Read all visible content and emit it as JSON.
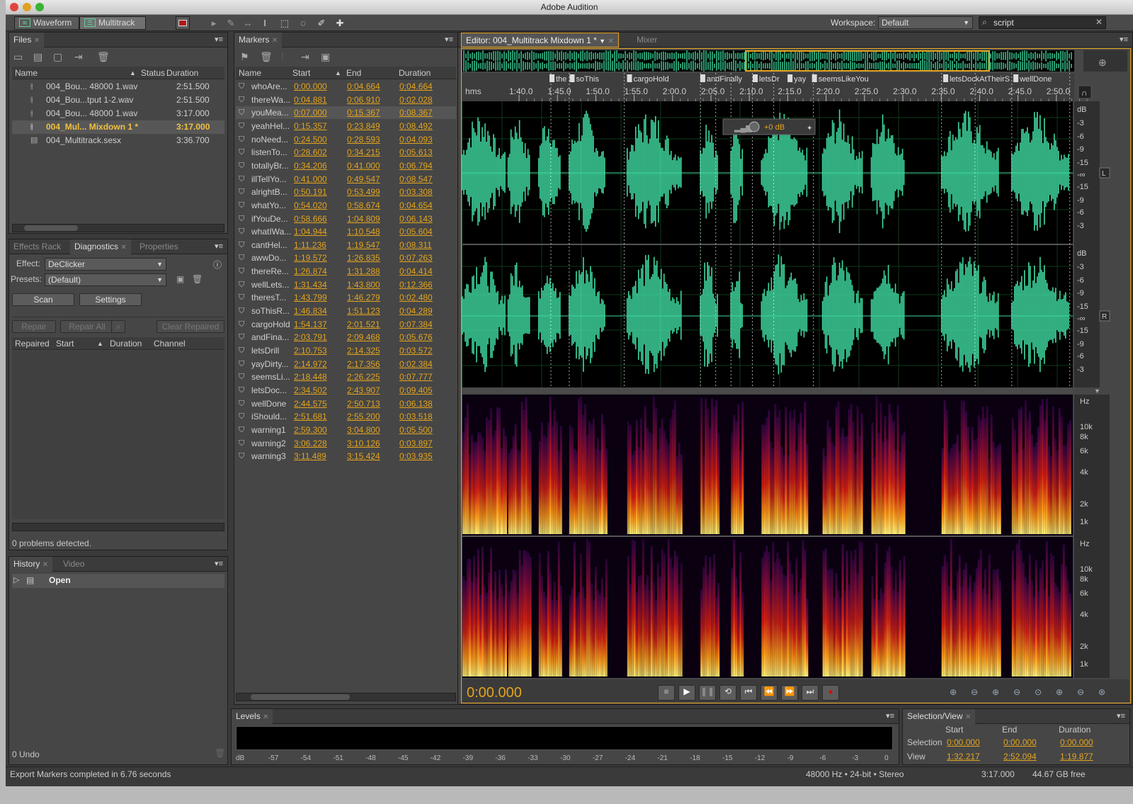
{
  "app": {
    "title": "Adobe Audition"
  },
  "toolbar": {
    "waveform_label": "Waveform",
    "multitrack_label": "Multitrack",
    "workspace_label": "Workspace:",
    "workspace_value": "Default",
    "search_value": "script"
  },
  "files": {
    "tab": "Files",
    "cols": {
      "name": "Name",
      "status": "Status",
      "duration": "Duration"
    },
    "rows": [
      {
        "name": "004_Bou... 48000 1.wav",
        "duration": "2:51.500"
      },
      {
        "name": "004_Bou...tput 1-2.wav",
        "duration": "2:51.500"
      },
      {
        "name": "004_Bou... 48000 1.wav",
        "duration": "3:17.000"
      },
      {
        "name": "004_Mul... Mixdown 1 *",
        "duration": "3:17.000"
      },
      {
        "name": "004_Multitrack.sesx",
        "duration": "3:36.700"
      }
    ]
  },
  "diagnostics": {
    "tabs": [
      "Effects Rack",
      "Diagnostics",
      "Properties"
    ],
    "effect_label": "Effect:",
    "effect_value": "DeClicker",
    "presets_label": "Presets:",
    "presets_value": "(Default)",
    "scan": "Scan",
    "settings": "Settings",
    "repair": "Repair",
    "repair_all": "Repair All",
    "clear_repaired": "Clear Repaired",
    "cols": {
      "repaired": "Repaired",
      "start": "Start",
      "duration": "Duration",
      "channel": "Channel"
    },
    "problems": "0 problems detected."
  },
  "history": {
    "tabs": [
      "History",
      "Video"
    ],
    "item": "Open",
    "undo": "0 Undo"
  },
  "markers": {
    "tab": "Markers",
    "cols": {
      "name": "Name",
      "start": "Start",
      "end": "End",
      "duration": "Duration"
    },
    "rows": [
      {
        "name": "whoAre...",
        "start": "0:00.000",
        "end": "0:04.664",
        "dur": "0:04.664"
      },
      {
        "name": "thereWa...",
        "start": "0:04.881",
        "end": "0:06.910",
        "dur": "0:02.028"
      },
      {
        "name": "youMea...",
        "start": "0:07.000",
        "end": "0:15.367",
        "dur": "0:08.367"
      },
      {
        "name": "yeahHel...",
        "start": "0:15.357",
        "end": "0:23.849",
        "dur": "0:08.492"
      },
      {
        "name": "noNeed...",
        "start": "0:24.500",
        "end": "0:28.593",
        "dur": "0:04.093"
      },
      {
        "name": "listenTo...",
        "start": "0:28.602",
        "end": "0:34.215",
        "dur": "0:05.613"
      },
      {
        "name": "totallyBr...",
        "start": "0:34.206",
        "end": "0:41.000",
        "dur": "0:06.794"
      },
      {
        "name": "illTellYo...",
        "start": "0:41.000",
        "end": "0:49.547",
        "dur": "0:08.547"
      },
      {
        "name": "alrightB...",
        "start": "0:50.191",
        "end": "0:53.499",
        "dur": "0:03.308"
      },
      {
        "name": "whatYo...",
        "start": "0:54.020",
        "end": "0:58.674",
        "dur": "0:04.654"
      },
      {
        "name": "ifYouDe...",
        "start": "0:58.666",
        "end": "1:04.809",
        "dur": "0:06.143"
      },
      {
        "name": "whatIWa...",
        "start": "1:04.944",
        "end": "1:10.548",
        "dur": "0:05.604"
      },
      {
        "name": "cantHel...",
        "start": "1:11.236",
        "end": "1:19.547",
        "dur": "0:08.311"
      },
      {
        "name": "awwDo...",
        "start": "1:19.572",
        "end": "1:26.835",
        "dur": "0:07.263"
      },
      {
        "name": "thereRe...",
        "start": "1:26.874",
        "end": "1:31.288",
        "dur": "0:04.414"
      },
      {
        "name": "wellLets...",
        "start": "1:31.434",
        "end": "1:43.800",
        "dur": "0:12.366"
      },
      {
        "name": "theresT...",
        "start": "1:43.799",
        "end": "1:46.279",
        "dur": "0:02.480"
      },
      {
        "name": "soThisR...",
        "start": "1:46.834",
        "end": "1:51.123",
        "dur": "0:04.289"
      },
      {
        "name": "cargoHold",
        "start": "1:54.137",
        "end": "2:01.521",
        "dur": "0:07.384"
      },
      {
        "name": "andFina...",
        "start": "2:03.791",
        "end": "2:09.468",
        "dur": "0:05.676"
      },
      {
        "name": "letsDrill",
        "start": "2:10.753",
        "end": "2:14.325",
        "dur": "0:03.572"
      },
      {
        "name": "yayDirty...",
        "start": "2:14.972",
        "end": "2:17.356",
        "dur": "0:02.384"
      },
      {
        "name": "seemsLi...",
        "start": "2:18.448",
        "end": "2:26.225",
        "dur": "0:07.777"
      },
      {
        "name": "letsDoc...",
        "start": "2:34.502",
        "end": "2:43.907",
        "dur": "0:09.405"
      },
      {
        "name": "wellDone",
        "start": "2:44.575",
        "end": "2:50.713",
        "dur": "0:06.138"
      },
      {
        "name": "iShould...",
        "start": "2:51.681",
        "end": "2:55.200",
        "dur": "0:03.518"
      },
      {
        "name": "warning1",
        "start": "2:59.300",
        "end": "3:04.800",
        "dur": "0:05.500"
      },
      {
        "name": "warning2",
        "start": "3:06.228",
        "end": "3:10.126",
        "dur": "0:03.897"
      },
      {
        "name": "warning3",
        "start": "3:11.489",
        "end": "3:15.424",
        "dur": "0:03.935"
      }
    ]
  },
  "editor": {
    "tab": "Editor: 004_Multitrack Mixdown 1 *",
    "mixer_tab": "Mixer",
    "ruler_unit": "hms",
    "ruler_ticks": [
      "1:40.0",
      "1:45.0",
      "1:50.0",
      "1:55.0",
      "2:00.0",
      "2:05.0",
      "2:10.0",
      "2:15.0",
      "2:20.0",
      "2:25.0",
      "2:30.0",
      "2:35.0",
      "2:40.0",
      "2:45.0",
      "2:50.0"
    ],
    "marker_labels": [
      "the",
      "soThis",
      "cargoHold",
      "andFinally",
      "letsDr",
      "yay",
      "seemsLikeYou",
      "letsDockAtTheirS",
      "wellDone"
    ],
    "hud_gain": "+0 dB",
    "db_ticks": [
      "dB",
      "-3",
      "-6",
      "-9",
      "-15",
      "-∞",
      "-15",
      "-9",
      "-6",
      "-3"
    ],
    "channel_left": "L",
    "channel_right": "R",
    "hz_ticks": [
      "Hz",
      "10k",
      "8k",
      "6k",
      "4k",
      "2k",
      "1k"
    ],
    "time_display": "0:00.000",
    "waveform_color": "#3fd9a0"
  },
  "levels": {
    "tab": "Levels",
    "scale": [
      "dB",
      "-57",
      "-54",
      "-51",
      "-48",
      "-45",
      "-42",
      "-39",
      "-36",
      "-33",
      "-30",
      "-27",
      "-24",
      "-21",
      "-18",
      "-15",
      "-12",
      "-9",
      "-6",
      "-3",
      "0"
    ]
  },
  "selection_view": {
    "tab": "Selection/View",
    "cols": {
      "start": "Start",
      "end": "End",
      "duration": "Duration"
    },
    "selection": {
      "label": "Selection",
      "start": "0:00.000",
      "end": "0:00.000",
      "duration": "0:00.000"
    },
    "view": {
      "label": "View",
      "start": "1:32.217",
      "end": "2:52.094",
      "duration": "1:19.877"
    }
  },
  "status": {
    "message": "Export Markers completed in 6.76 seconds",
    "format": "48000 Hz • 24-bit • Stereo",
    "length": "3:17.000",
    "free": "44.67 GB free"
  }
}
